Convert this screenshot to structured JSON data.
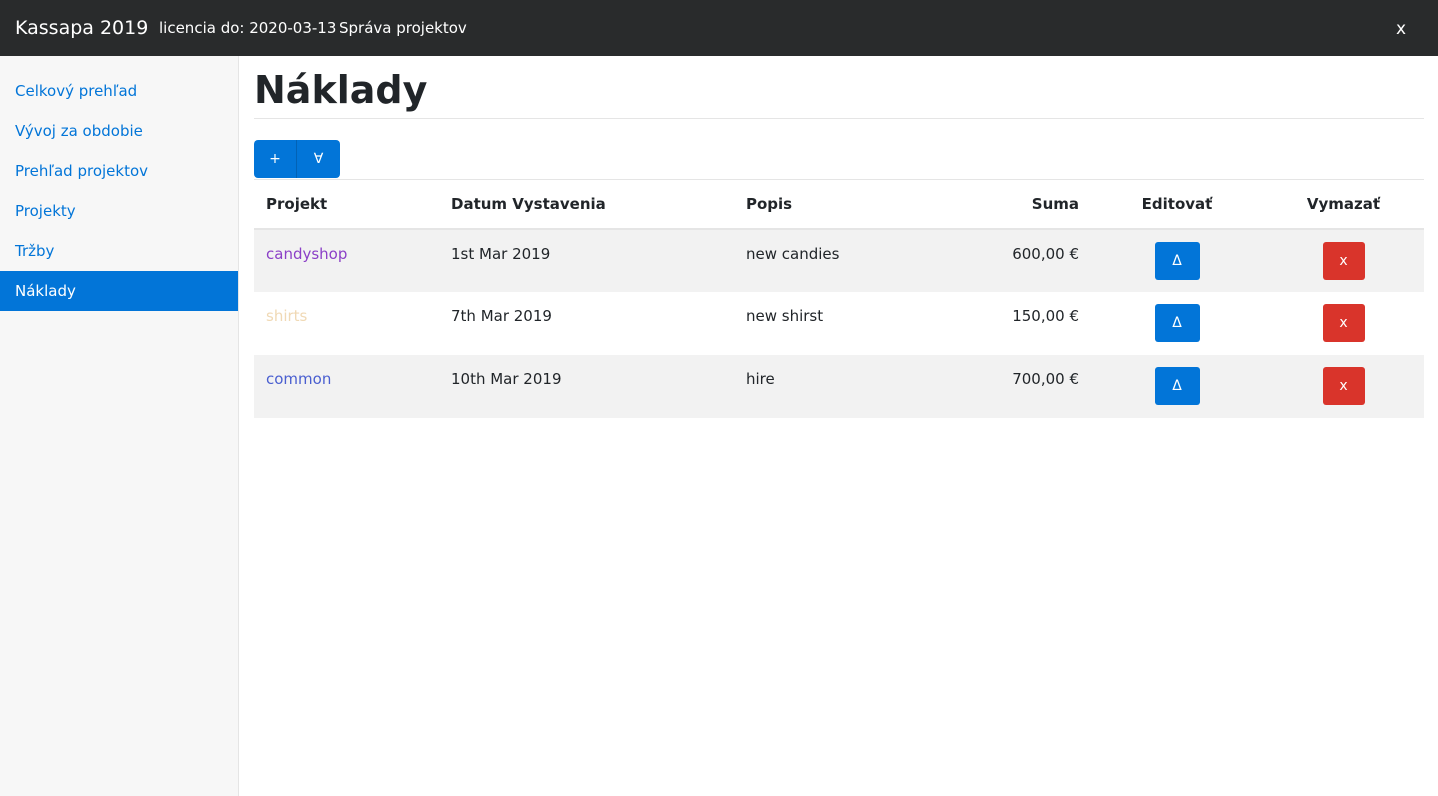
{
  "topbar": {
    "brand": "Kassapa 2019",
    "license": "licencia do: 2020-03-13",
    "manage": "Správa projektov",
    "close": "x"
  },
  "sidebar": {
    "items": [
      {
        "label": "Celkový prehľad"
      },
      {
        "label": "Vývoj za obdobie"
      },
      {
        "label": "Prehľad projektov"
      },
      {
        "label": "Projekty"
      },
      {
        "label": "Tržby"
      },
      {
        "label": "Náklady"
      }
    ]
  },
  "main": {
    "title": "Náklady",
    "toolbar": {
      "add": "+",
      "all": "∀"
    },
    "table": {
      "headers": {
        "project": "Projekt",
        "date": "Datum Vystavenia",
        "desc": "Popis",
        "sum": "Suma",
        "edit": "Editovať",
        "delete": "Vymazať"
      },
      "rows": [
        {
          "project": "candyshop",
          "color": "#8b3fc7",
          "date": "1st Mar 2019",
          "desc": "new candies",
          "sum": "600,00 €",
          "edit": "Δ",
          "delete": "x"
        },
        {
          "project": "shirts",
          "color": "#f0d9b5",
          "date": "7th Mar 2019",
          "desc": "new shirst",
          "sum": "150,00 €",
          "edit": "Δ",
          "delete": "x"
        },
        {
          "project": "common",
          "color": "#4a5fd0",
          "date": "10th Mar 2019",
          "desc": "hire",
          "sum": "700,00 €",
          "edit": "Δ",
          "delete": "x"
        }
      ]
    }
  },
  "colors": {
    "accent": "#0275d8",
    "danger": "#d9342b",
    "topbar": "#292b2c"
  }
}
